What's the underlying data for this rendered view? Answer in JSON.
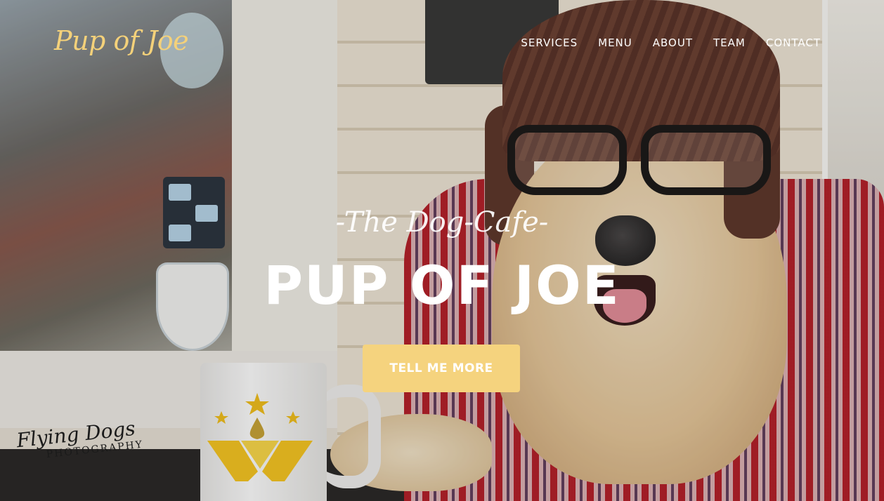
{
  "brand": {
    "name": "Pup of Joe"
  },
  "nav": {
    "items": [
      {
        "label": "SERVICES"
      },
      {
        "label": "MENU"
      },
      {
        "label": "ABOUT"
      },
      {
        "label": "TEAM"
      },
      {
        "label": "CONTACT"
      }
    ]
  },
  "hero": {
    "subtitle": "-The Dog-Cafe-",
    "title": "PUP OF JOE",
    "cta_label": "TELL ME MORE",
    "watermark_line1": "Flying Dogs",
    "watermark_line2": "PHOTOGRAPHY"
  },
  "colors": {
    "brand_accent": "#f4d17a",
    "cta_background": "#f5d37e",
    "nav_text": "#ffffff"
  }
}
